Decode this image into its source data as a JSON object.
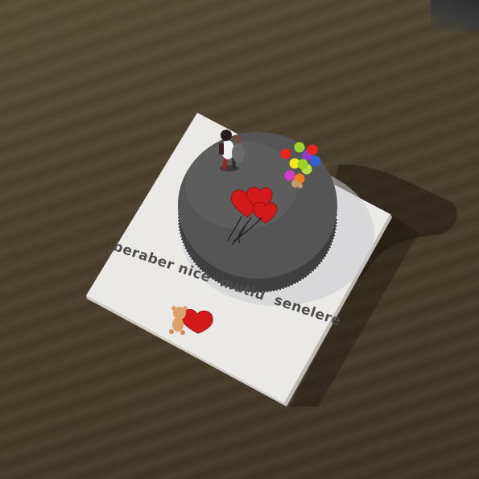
{
  "scene": {
    "message": "beraber nice  mutlu  senelere",
    "colors": {
      "table": "#4b402c",
      "board": "#ebe9e5",
      "cake": "#555555",
      "hearts": "#d21a1a",
      "text": "#4d4d4d"
    },
    "balloon_colors": [
      "#e8251f",
      "#9bd12a",
      "#8a3fd1",
      "#f2e61c",
      "#2a63d6",
      "#d43fc7",
      "#b6e04a",
      "#f07a1e"
    ]
  }
}
